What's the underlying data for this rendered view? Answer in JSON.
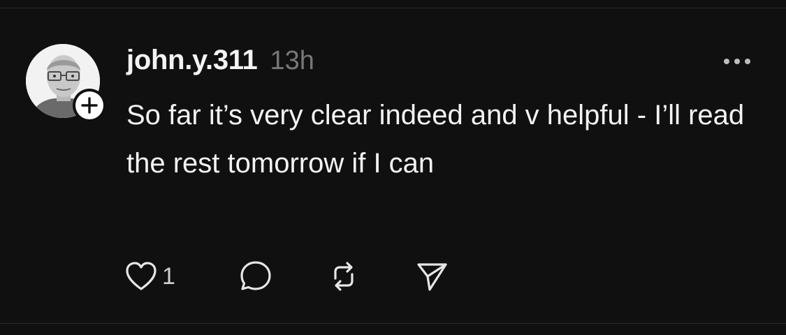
{
  "post": {
    "username": "john.y.311",
    "timestamp": "13h",
    "text": "So far it’s very clear indeed and v helpful - I’ll read the rest tomorrow if I can",
    "like_count": "1"
  },
  "icons": {
    "more": "more-horizontal-icon",
    "follow": "plus-icon",
    "like": "heart-icon",
    "reply": "comment-bubble-icon",
    "repost": "repost-icon",
    "share": "send-icon"
  },
  "colors": {
    "background": "#101010",
    "text": "#f3f3f3",
    "secondary_text": "#777777",
    "divider": "#2b2b2b"
  }
}
